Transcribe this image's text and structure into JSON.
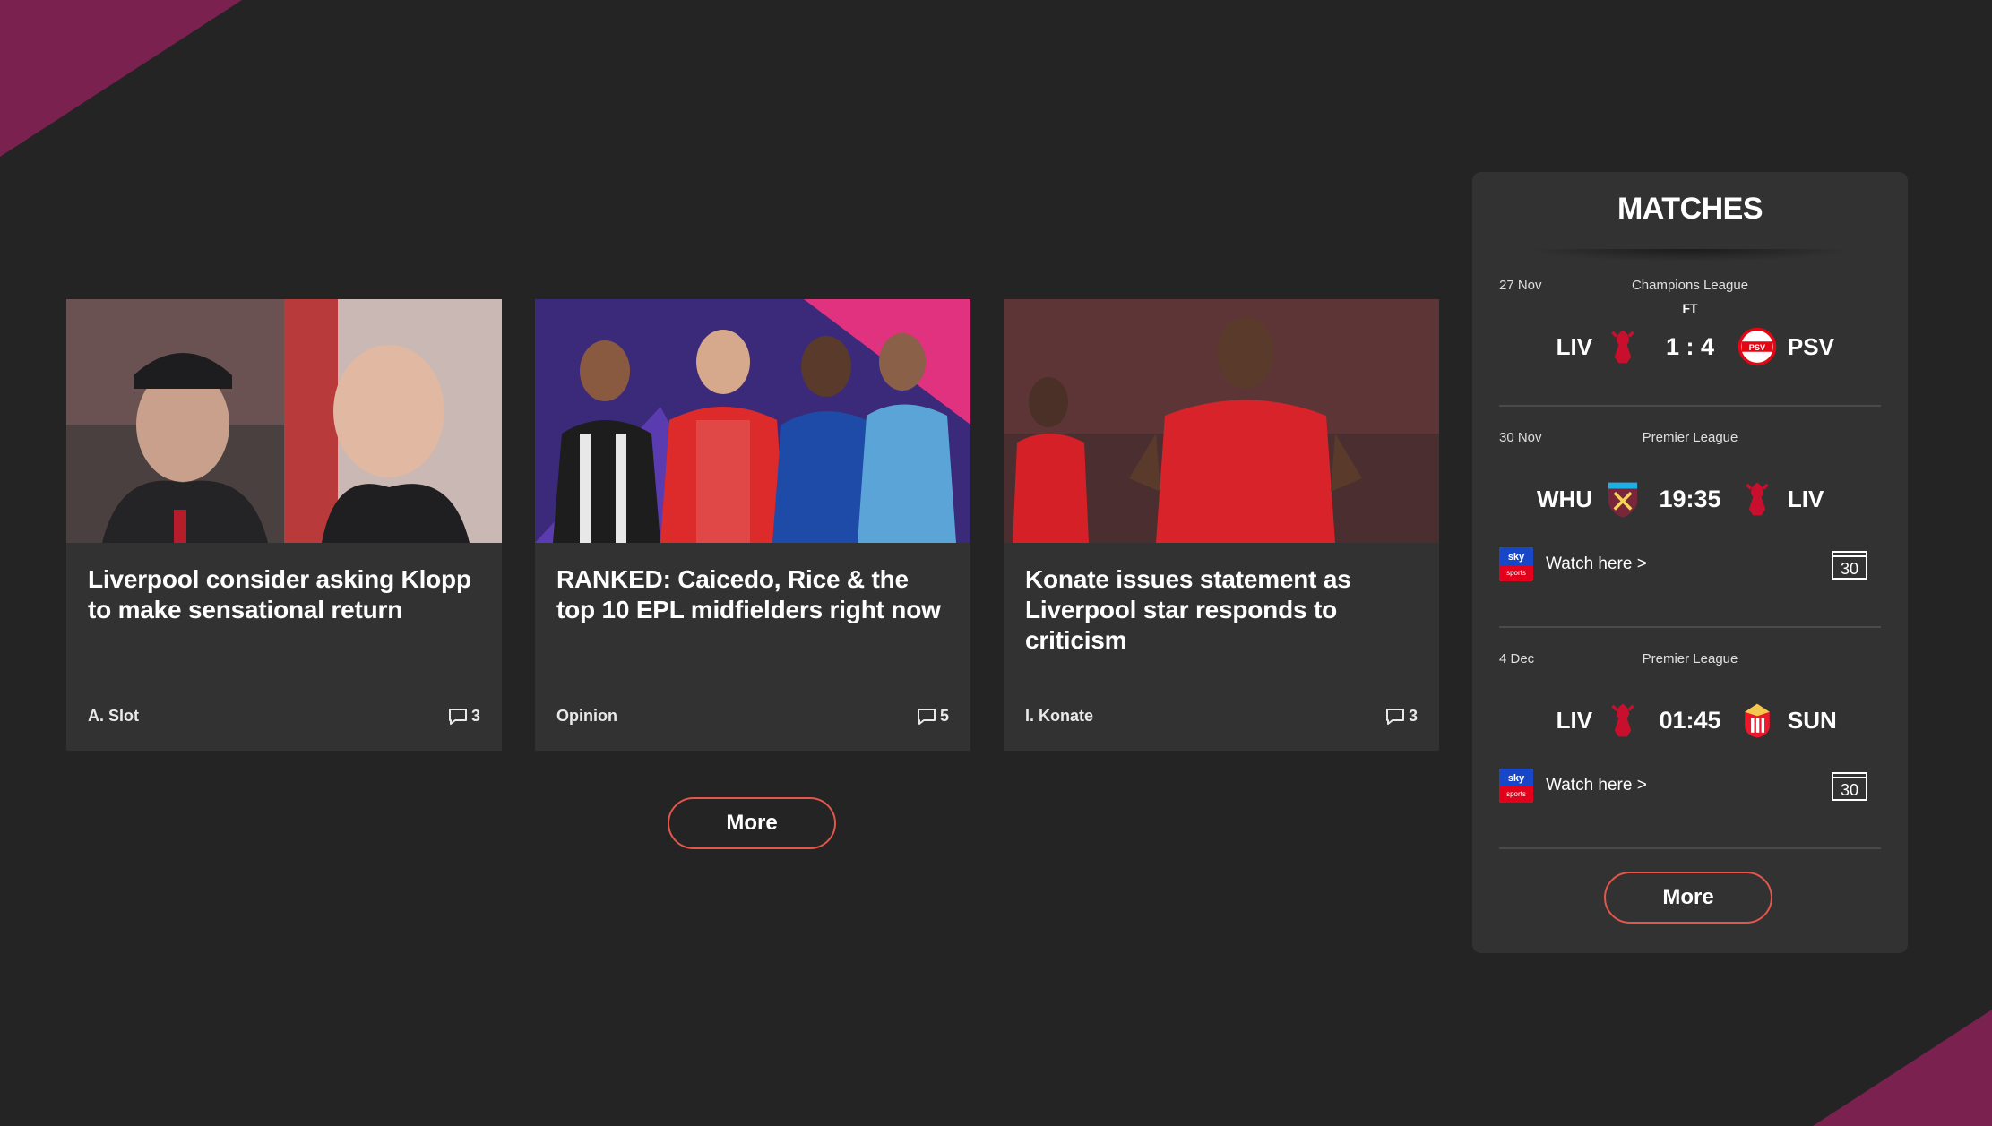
{
  "articles": [
    {
      "title": "Liverpool consider asking Klopp to make sensational return",
      "tag": "A. Slot",
      "comments": "3"
    },
    {
      "title": "RANKED: Caicedo, Rice & the top 10 EPL midfielders right now",
      "tag": "Opinion",
      "comments": "5"
    },
    {
      "title": "Konate issues statement as Liverpool star responds to criticism",
      "tag": "I. Konate",
      "comments": "3"
    }
  ],
  "articles_more_label": "More",
  "matches": {
    "title": "MATCHES",
    "items": [
      {
        "date": "27 Nov",
        "competition": "Champions League",
        "status": "FT",
        "home": "LIV",
        "score": "1 : 4",
        "away": "PSV"
      },
      {
        "date": "30 Nov",
        "competition": "Premier League",
        "home": "WHU",
        "score": "19:35",
        "away": "LIV",
        "watch_label": "Watch here >",
        "calendar_day": "30"
      },
      {
        "date": "4 Dec",
        "competition": "Premier League",
        "home": "LIV",
        "score": "01:45",
        "away": "SUN",
        "watch_label": "Watch here >",
        "calendar_day": "30"
      }
    ],
    "more_label": "More"
  },
  "sky_logo_text": {
    "top": "sky",
    "bottom": "sports"
  },
  "colors": {
    "accent": "#e4564a",
    "brand": "#7a2150",
    "panel": "#323233",
    "background": "#242425"
  }
}
